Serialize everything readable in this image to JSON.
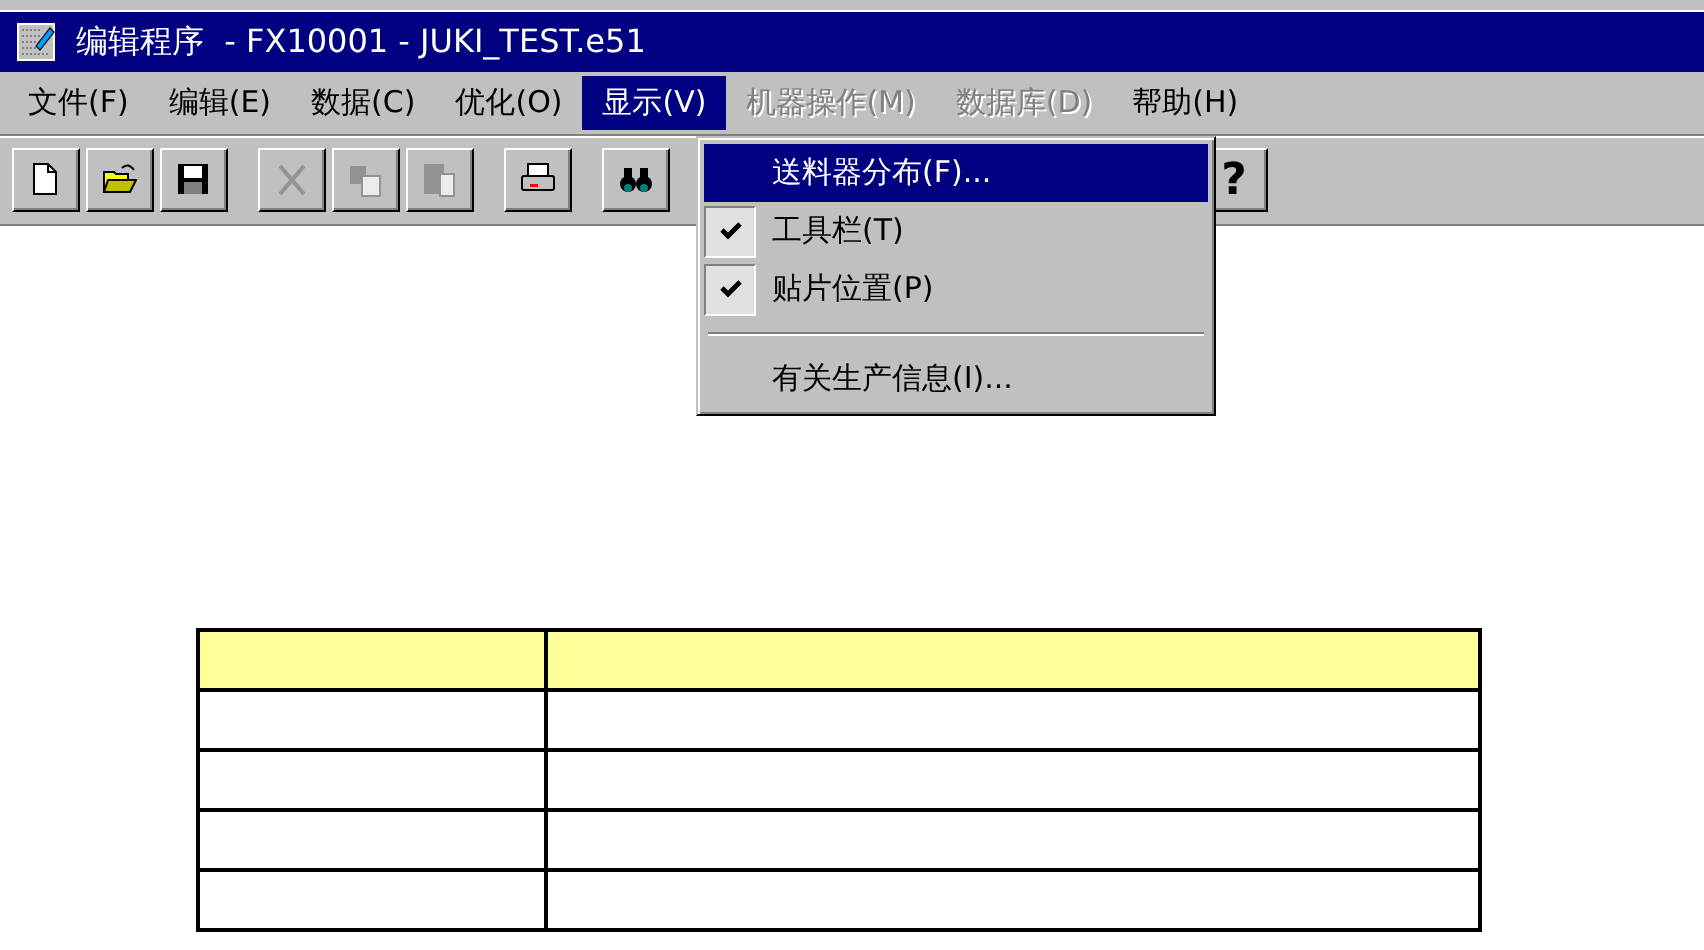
{
  "window": {
    "title": "编辑程序  - FX10001 - JUKI_TEST.e51"
  },
  "menu_bar": [
    {
      "label": "文件(F)",
      "selected": false,
      "disabled": false
    },
    {
      "label": "编辑(E)",
      "selected": false,
      "disabled": false
    },
    {
      "label": "数据(C)",
      "selected": false,
      "disabled": false
    },
    {
      "label": "优化(O)",
      "selected": false,
      "disabled": false
    },
    {
      "label": "显示(V)",
      "selected": true,
      "disabled": false
    },
    {
      "label": "机器操作(M)",
      "selected": false,
      "disabled": true
    },
    {
      "label": "数据库(D)",
      "selected": false,
      "disabled": true
    },
    {
      "label": "帮助(H)",
      "selected": false,
      "disabled": false
    }
  ],
  "toolbar": [
    {
      "kind": "new",
      "disabled": false
    },
    {
      "kind": "open",
      "disabled": false
    },
    {
      "kind": "save",
      "disabled": false
    },
    {
      "kind": "separator"
    },
    {
      "kind": "cut",
      "disabled": true
    },
    {
      "kind": "copy",
      "disabled": true
    },
    {
      "kind": "paste",
      "disabled": true
    },
    {
      "kind": "separator"
    },
    {
      "kind": "print",
      "disabled": false
    },
    {
      "kind": "separator"
    },
    {
      "kind": "find",
      "disabled": false
    },
    {
      "kind": "help",
      "label": "?",
      "disabled": false
    }
  ],
  "dropdown": [
    {
      "kind": "item",
      "label": "送料器分布(F)...",
      "selected": true,
      "checked": false
    },
    {
      "kind": "item",
      "label": "工具栏(T)",
      "selected": false,
      "checked": true
    },
    {
      "kind": "item",
      "label": "贴片位置(P)",
      "selected": false,
      "checked": true
    },
    {
      "kind": "separator"
    },
    {
      "kind": "item",
      "label": "有关生产信息(I)...",
      "selected": false,
      "checked": false
    }
  ],
  "table": {
    "rows": [
      {
        "kind": "header"
      },
      {
        "kind": "body"
      },
      {
        "kind": "body"
      },
      {
        "kind": "body"
      },
      {
        "kind": "body"
      }
    ]
  }
}
